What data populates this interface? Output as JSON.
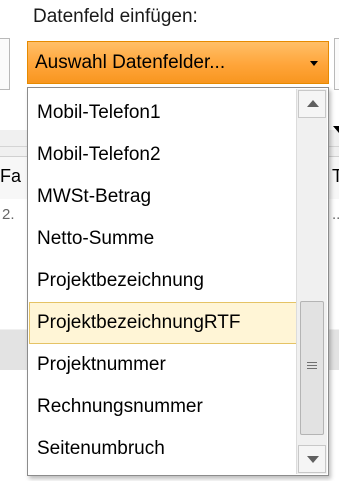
{
  "label": "Datenfeld einfügen:",
  "combo": {
    "value": "Auswahl Datenfelder...",
    "arrow_icon": "chevron-down-icon"
  },
  "background_fragments": {
    "left_col": "Fa",
    "left_num": "2.",
    "right_col": "Ta",
    "right_dots": "..."
  },
  "list": {
    "items": [
      {
        "label": "Mobil-Telefon1"
      },
      {
        "label": "Mobil-Telefon2"
      },
      {
        "label": "MWSt-Betrag"
      },
      {
        "label": "Netto-Summe"
      },
      {
        "label": "Projektbezeichnung"
      },
      {
        "label": "ProjektbezeichnungRTF"
      },
      {
        "label": "Projektnummer"
      },
      {
        "label": "Rechnungsnummer"
      },
      {
        "label": "Seitenumbruch"
      }
    ],
    "selected_index": 5
  },
  "colors": {
    "combo_accent": "#ffa53a",
    "selection_bg": "#fff5d6",
    "selection_border": "#e5c365"
  }
}
